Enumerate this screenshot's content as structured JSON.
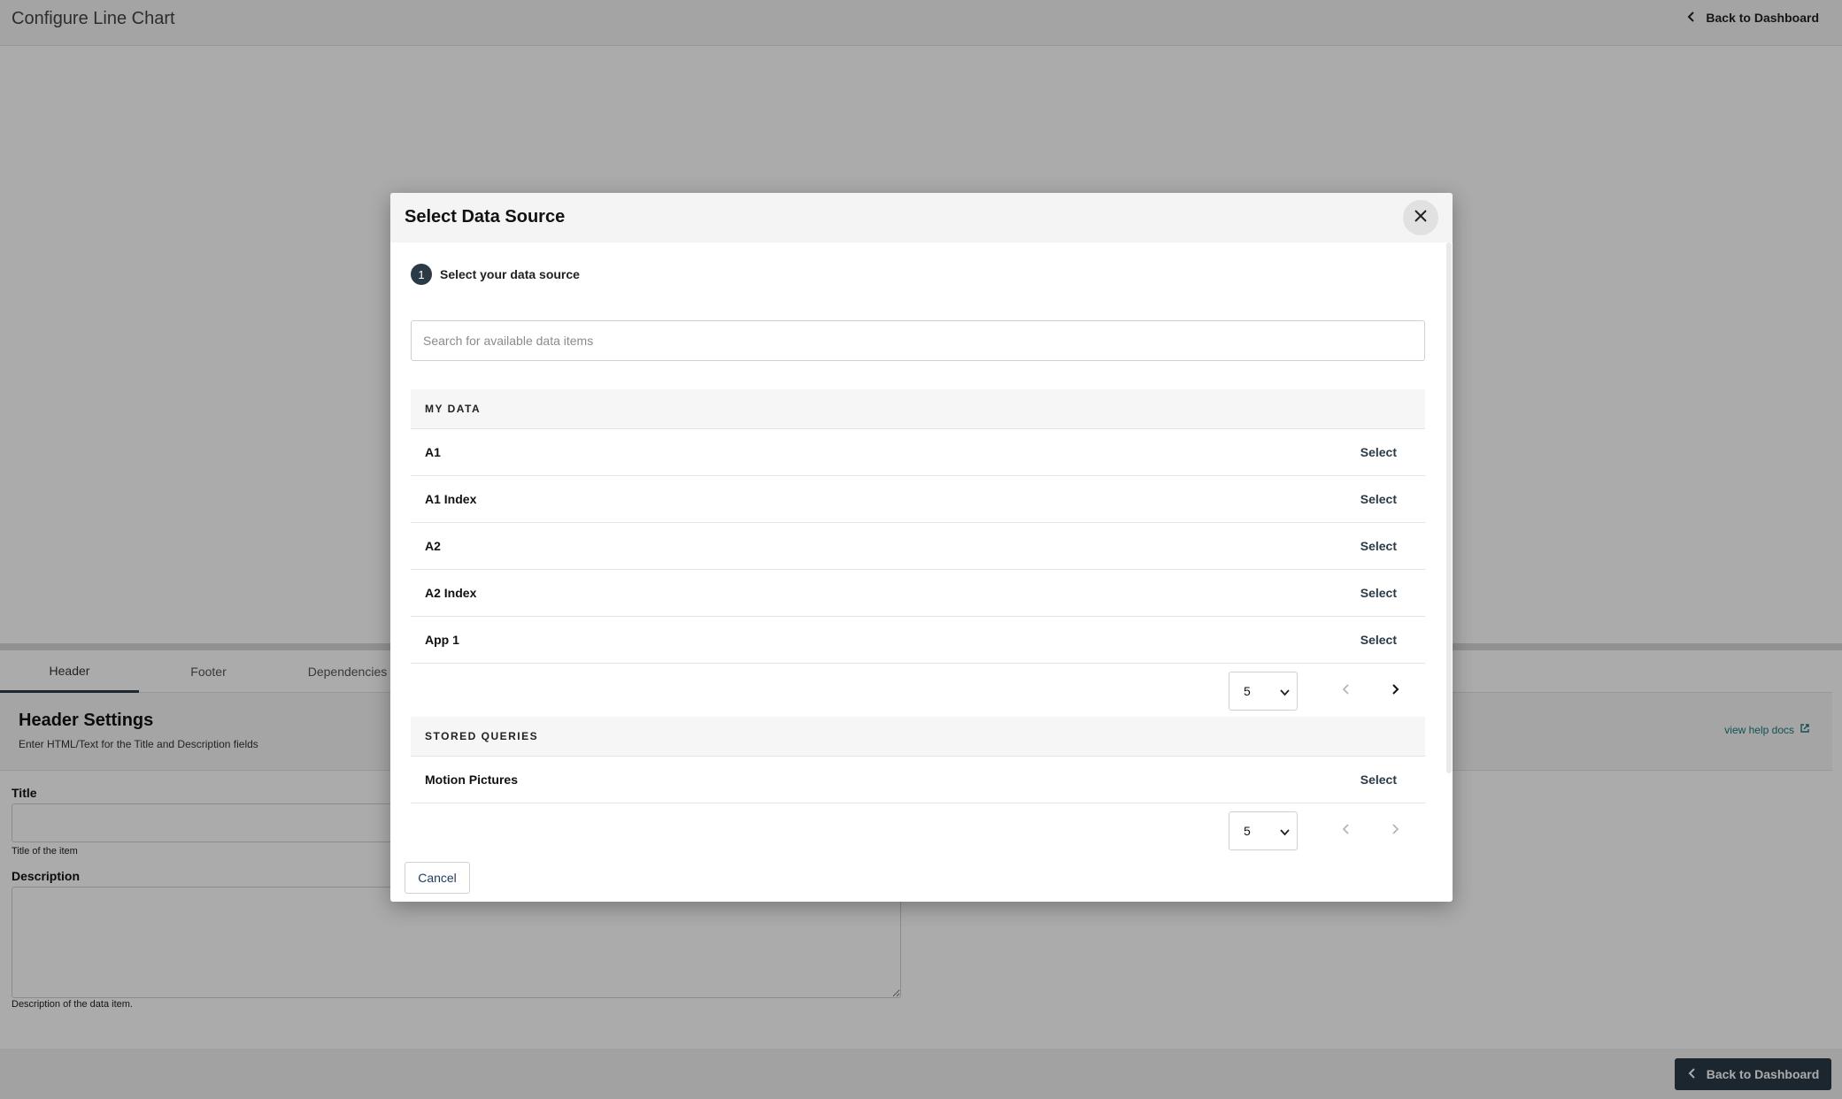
{
  "app": {
    "title": "Configure Line Chart",
    "back_label": "Back to Dashboard"
  },
  "tabs": [
    {
      "label": "Header",
      "active": true
    },
    {
      "label": "Footer",
      "active": false
    },
    {
      "label": "Dependencies",
      "active": false
    }
  ],
  "header_settings": {
    "title": "Header Settings",
    "subtitle": "Enter HTML/Text for the Title and Description fields",
    "help_link": "view help docs",
    "title_label": "Title",
    "title_value": "",
    "title_help": "Title of the item",
    "description_label": "Description",
    "description_value": "",
    "description_help": "Description of the data item."
  },
  "bottom_bar": {
    "back_button_label": "Back to Dashboard"
  },
  "modal": {
    "title": "Select Data Source",
    "step_number": "1",
    "step_label": "Select your data source",
    "search_placeholder": "Search for available data items",
    "search_value": "",
    "my_data": {
      "heading": "MY DATA",
      "items": [
        {
          "name": "A1",
          "action": "Select"
        },
        {
          "name": "A1 Index",
          "action": "Select"
        },
        {
          "name": "A2",
          "action": "Select"
        },
        {
          "name": "A2 Index",
          "action": "Select"
        },
        {
          "name": "App 1",
          "action": "Select"
        }
      ],
      "page_size": "5",
      "prev_enabled": false,
      "next_enabled": true
    },
    "stored_queries": {
      "heading": "STORED QUERIES",
      "items": [
        {
          "name": "Motion Pictures",
          "action": "Select"
        }
      ],
      "page_size": "5",
      "prev_enabled": false,
      "next_enabled": false
    },
    "cancel_label": "Cancel"
  },
  "colors": {
    "primary_dark": "#2b3a47",
    "link_teal": "#1a7a7a",
    "disabled": "#b5b5b5"
  }
}
